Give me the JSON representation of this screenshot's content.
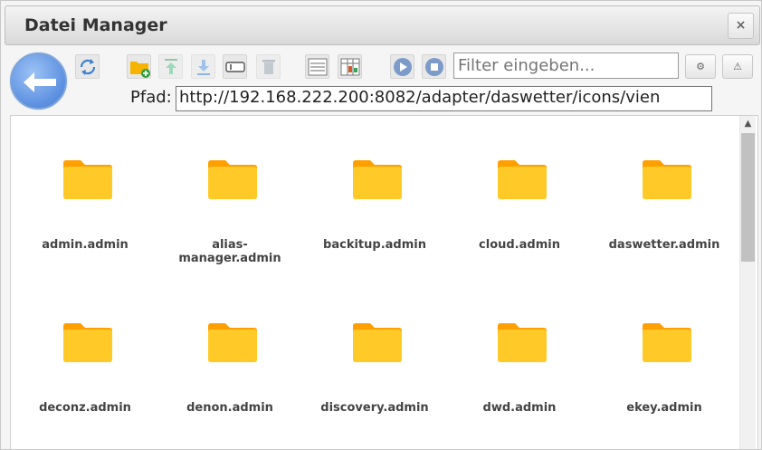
{
  "window": {
    "title": "Datei Manager",
    "close_glyph": "×"
  },
  "toolbar": {
    "back_icon": "back-arrow-icon",
    "buttons": [
      {
        "name": "refresh-button",
        "icon": "refresh-icon"
      },
      {
        "name": "new-folder-button",
        "icon": "folder-add-icon"
      },
      {
        "name": "upload-button",
        "icon": "upload-icon"
      },
      {
        "name": "download-button",
        "icon": "download-icon"
      },
      {
        "name": "rename-button",
        "icon": "rename-icon"
      },
      {
        "name": "delete-button",
        "icon": "trash-icon"
      },
      {
        "name": "list-view-button",
        "icon": "list-view-icon"
      },
      {
        "name": "table-view-button",
        "icon": "table-view-icon"
      },
      {
        "name": "play-button",
        "icon": "play-icon"
      },
      {
        "name": "stop-button",
        "icon": "stop-icon"
      }
    ],
    "filter_placeholder": "Filter eingeben...",
    "settings_glyph": "⚙",
    "warning_glyph": "⚠"
  },
  "path": {
    "label": "Pfad:",
    "value": "http://192.168.222.200:8082/adapter/daswetter/icons/vien"
  },
  "files": [
    {
      "name": "admin.admin",
      "type": "folder"
    },
    {
      "name": "alias-manager.admin",
      "type": "folder"
    },
    {
      "name": "backitup.admin",
      "type": "folder"
    },
    {
      "name": "cloud.admin",
      "type": "folder"
    },
    {
      "name": "daswetter.admin",
      "type": "folder"
    },
    {
      "name": "deconz.admin",
      "type": "folder"
    },
    {
      "name": "denon.admin",
      "type": "folder"
    },
    {
      "name": "discovery.admin",
      "type": "folder"
    },
    {
      "name": "dwd.admin",
      "type": "folder"
    },
    {
      "name": "ekey.admin",
      "type": "folder"
    }
  ],
  "colors": {
    "folder_main": "#FFCA28",
    "folder_tab": "#FFA000",
    "accent_blue": "#5b8fe0"
  }
}
